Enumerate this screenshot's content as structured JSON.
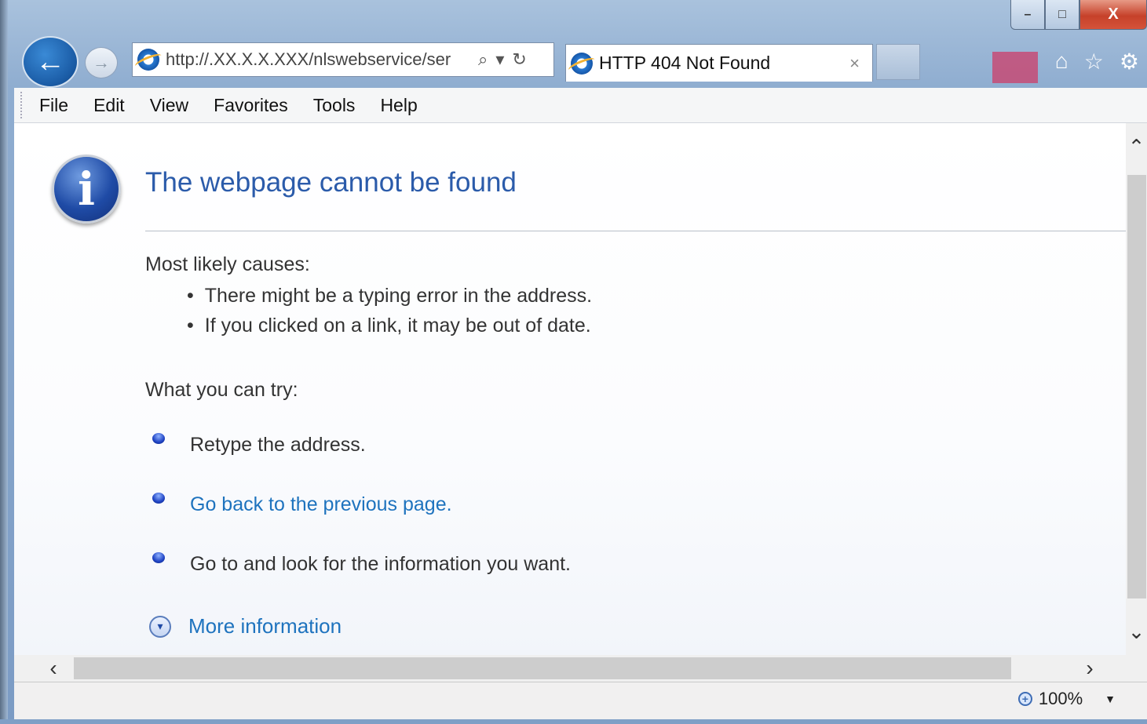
{
  "window": {
    "caption_buttons": {
      "minimize": "–",
      "maximize": "□",
      "close": "X"
    }
  },
  "toolbar": {
    "back_glyph": "←",
    "forward_glyph": "→",
    "address_url": "http://.XX.X.X.XXX/nlswebservice/ser",
    "address_icons": {
      "search": "⌕",
      "dropdown": "▾",
      "refresh": "↻"
    },
    "tab_title": "HTTP 404 Not Found",
    "tab_close": "×",
    "right_icons": {
      "home": "⌂",
      "favorites": "☆",
      "tools": "⚙"
    }
  },
  "menubar": {
    "items": [
      "File",
      "Edit",
      "View",
      "Favorites",
      "Tools",
      "Help"
    ]
  },
  "page": {
    "info_icon_glyph": "i",
    "title": "The webpage cannot be found",
    "causes_heading": "Most likely causes:",
    "causes": [
      "There might be a typing error in the address.",
      "If you clicked on a link, it may be out of date."
    ],
    "try_heading": "What you can try:",
    "try_items": [
      {
        "text": "Retype the address.",
        "is_link": false
      },
      {
        "text": "Go back to the previous page.",
        "is_link": true
      },
      {
        "text": "Go to  and look for the information you want.",
        "is_link": false
      }
    ],
    "more_info": "More information",
    "more_info_icon": "▾"
  },
  "scrollbars": {
    "up": "⌃",
    "down": "⌄",
    "left": "‹",
    "right": "›"
  },
  "statusbar": {
    "zoom_level": "100%",
    "zoom_icon": "+",
    "zoom_dropdown": "▼"
  }
}
